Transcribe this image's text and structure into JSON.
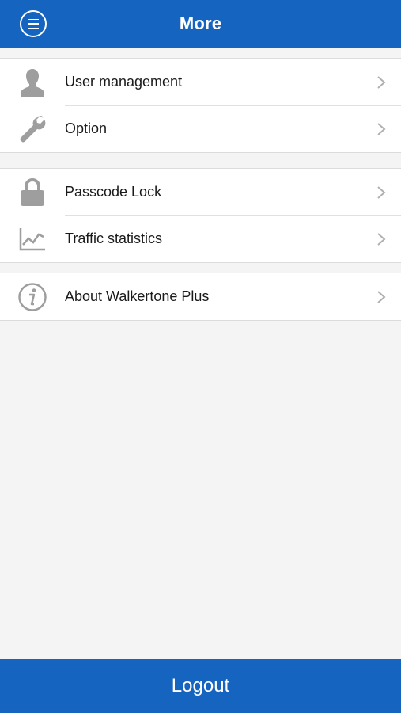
{
  "header": {
    "title": "More",
    "menu_icon": "menu-circle-icon"
  },
  "groups": [
    {
      "items": [
        {
          "label": "User management",
          "icon": "user-icon"
        },
        {
          "label": "Option",
          "icon": "wrench-icon"
        }
      ]
    },
    {
      "items": [
        {
          "label": "Passcode Lock",
          "icon": "lock-icon"
        },
        {
          "label": "Traffic statistics",
          "icon": "chart-line-icon"
        }
      ]
    },
    {
      "items": [
        {
          "label": "About Walkertone Plus",
          "icon": "info-icon"
        }
      ]
    }
  ],
  "footer": {
    "logout_label": "Logout"
  },
  "colors": {
    "primary": "#1565c0",
    "background": "#f4f4f4",
    "icon_gray": "#9e9e9e"
  }
}
